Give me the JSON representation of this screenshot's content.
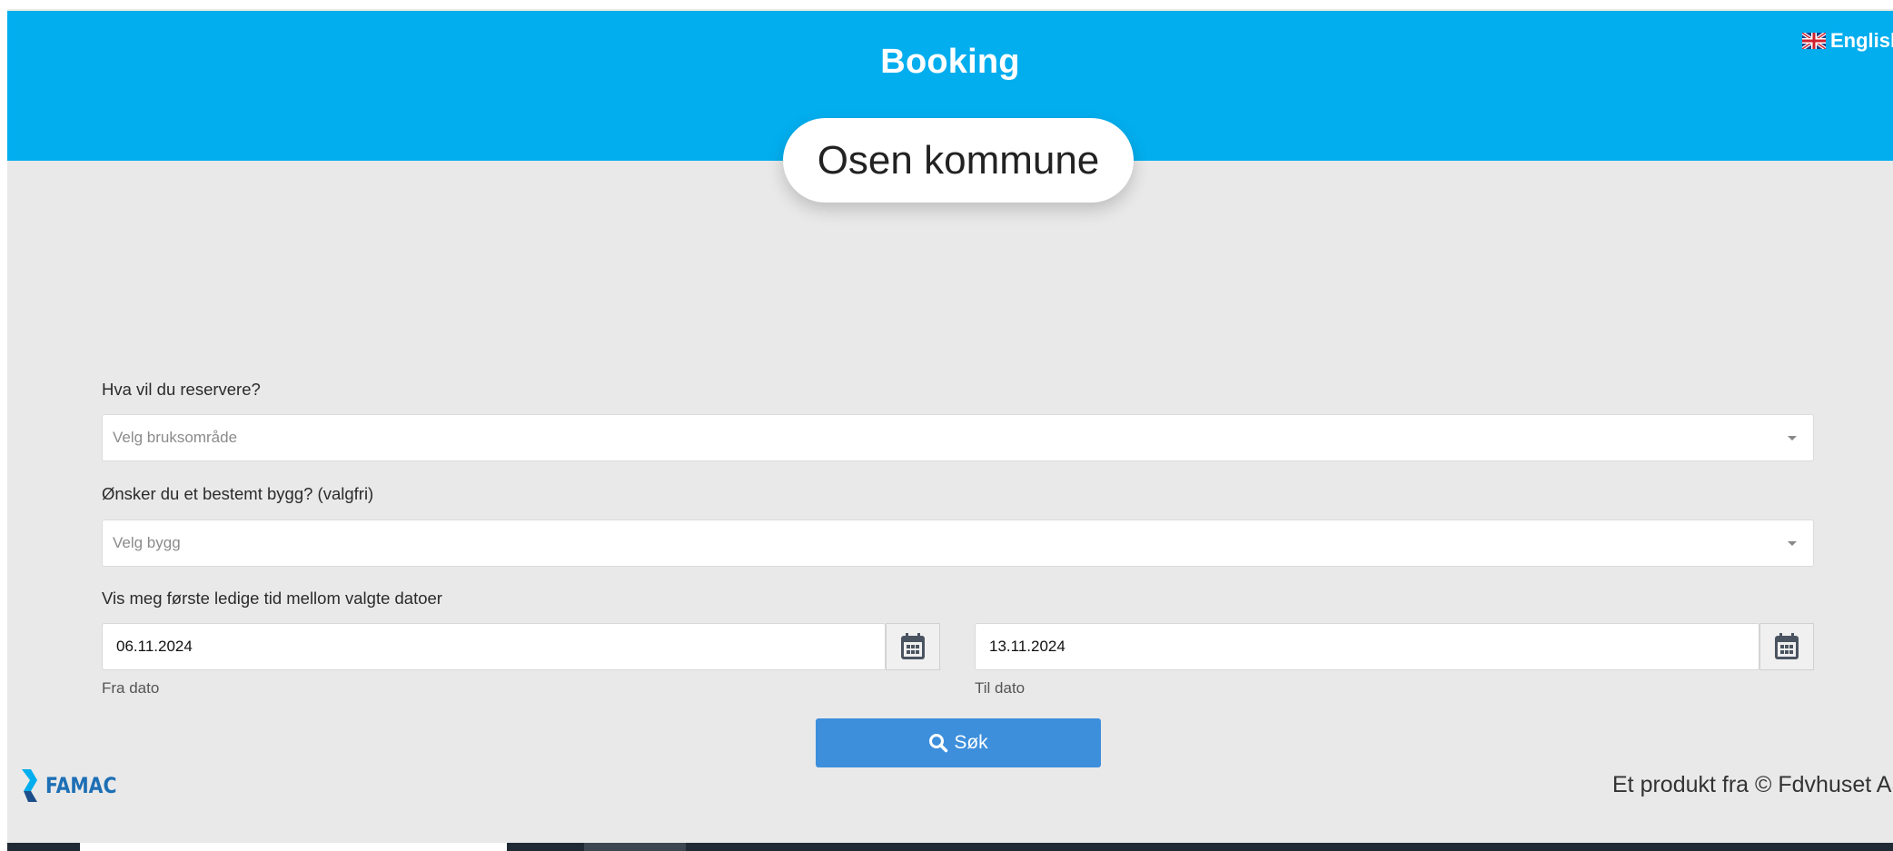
{
  "header": {
    "title": "Booking",
    "language": "English",
    "language_icon": "uk-flag-icon"
  },
  "organization": {
    "name": "Osen kommune"
  },
  "form": {
    "usage_label": "Hva vil du reservere?",
    "usage_placeholder": "Velg bruksområde",
    "building_label": "Ønsker du et bestemt bygg? (valgfri)",
    "building_placeholder": "Velg bygg",
    "dates_label": "Vis meg første ledige tid mellom valgte datoer",
    "from_date": "06.11.2024",
    "from_helper": "Fra dato",
    "to_date": "13.11.2024",
    "to_helper": "Til dato",
    "search_label": "Søk",
    "search_icon": "search-icon",
    "calendar_icon": "calendar-icon"
  },
  "footer": {
    "brand": "FAMAC",
    "credit": "Et produkt fra © Fdvhuset AS"
  },
  "colors": {
    "header_bg": "#03aeee",
    "page_bg": "#e9e9e9",
    "button_bg": "#3d8fdc",
    "brand": "#1d6fb5"
  }
}
